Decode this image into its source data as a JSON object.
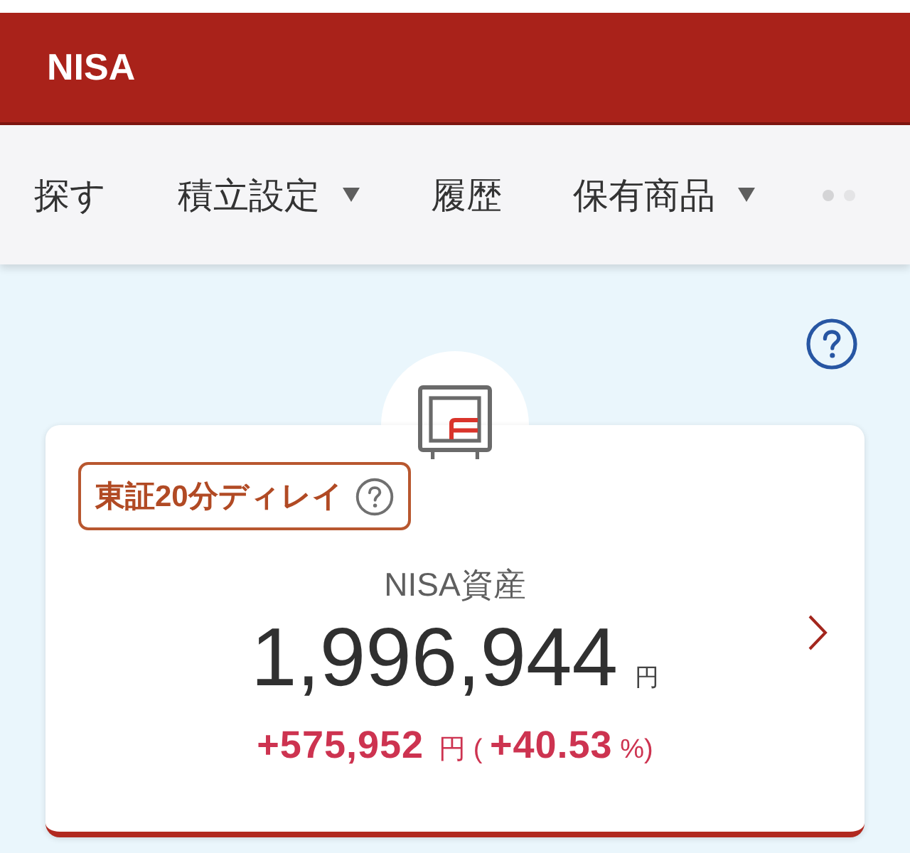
{
  "header": {
    "title": "NISA"
  },
  "tabs": [
    {
      "label": "探す",
      "has_menu": false
    },
    {
      "label": "積立設定",
      "has_menu": true
    },
    {
      "label": "履歴",
      "has_menu": false
    },
    {
      "label": "保有商品",
      "has_menu": true
    }
  ],
  "asset_card": {
    "delay_badge": "東証20分ディレイ",
    "label": "NISA資産",
    "total": "1,996,944",
    "total_unit": "円",
    "gain_line": "**+575,952**  円 ( **+40.53** %)"
  }
}
